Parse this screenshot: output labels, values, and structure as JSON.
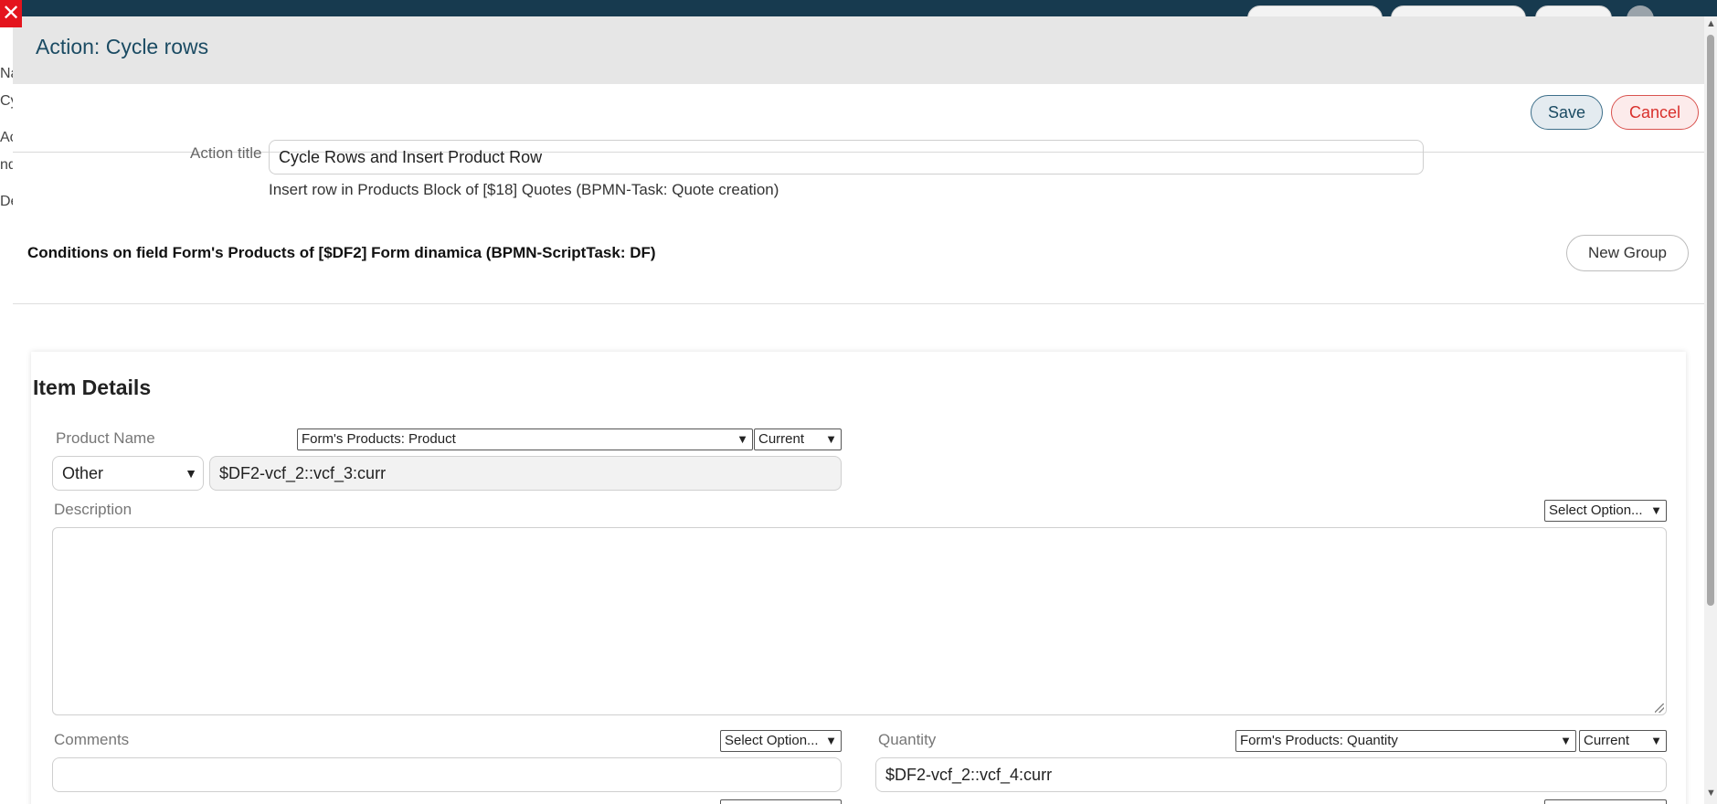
{
  "background": {
    "left_fragments": [
      "Na",
      "Cy",
      "Ac",
      "nd",
      "De"
    ]
  },
  "modal": {
    "title": "Action: Cycle rows",
    "save_label": "Save",
    "cancel_label": "Cancel",
    "action_title_label": "Action title",
    "action_title_value": "Cycle Rows and Insert Product Row",
    "subtext": "Insert row in Products Block of [$18] Quotes (BPMN-Task: Quote creation)",
    "conditions_text": "Conditions on field Form's Products of [$DF2] Form dinamica (BPMN-ScriptTask: DF)",
    "new_group_label": "New Group"
  },
  "item_details": {
    "title": "Item Details",
    "product_name": {
      "label": "Product Name",
      "source_select": "Form's Products: Product",
      "row_select": "Current",
      "type_select": "Other",
      "value": "$DF2-vcf_2::vcf_3:curr"
    },
    "description": {
      "label": "Description",
      "option_select": "Select Option...",
      "value": ""
    },
    "comments": {
      "label": "Comments",
      "option_select": "Select Option...",
      "value": ""
    },
    "quantity": {
      "label": "Quantity",
      "source_select": "Form's Products: Quantity",
      "row_select": "Current",
      "value": "$DF2-vcf_2::vcf_4:curr"
    }
  },
  "colors": {
    "header_bg": "#e6e6e6",
    "title_color": "#1b4b63",
    "cancel_red": "#d9302c",
    "close_red": "#e4141d",
    "topbar": "#173a4f"
  }
}
